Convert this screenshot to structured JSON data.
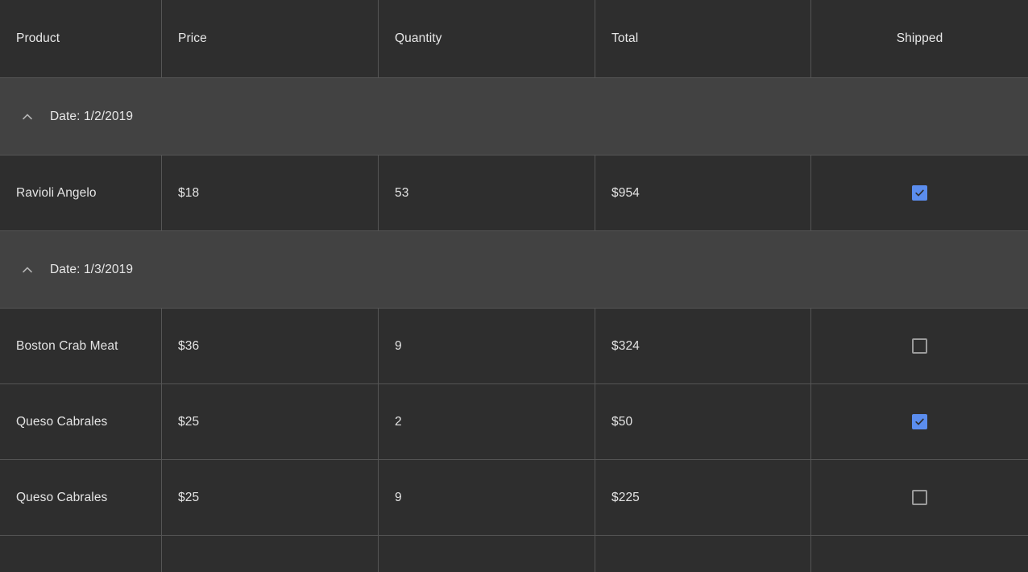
{
  "grid": {
    "columns": [
      {
        "key": "product",
        "label": "Product",
        "align": "left"
      },
      {
        "key": "price",
        "label": "Price",
        "align": "left"
      },
      {
        "key": "quantity",
        "label": "Quantity",
        "align": "left"
      },
      {
        "key": "total",
        "label": "Total",
        "align": "left"
      },
      {
        "key": "shipped",
        "label": "Shipped",
        "align": "center"
      }
    ],
    "groups": [
      {
        "label": "Date: 1/2/2019",
        "expanded": true,
        "collapse_icon": "chevron-up-icon",
        "rows": [
          {
            "product": "Ravioli Angelo",
            "price": "$18",
            "quantity": "53",
            "total": "$954",
            "shipped": true
          }
        ]
      },
      {
        "label": "Date: 1/3/2019",
        "expanded": true,
        "collapse_icon": "chevron-up-icon",
        "rows": [
          {
            "product": "Boston Crab Meat",
            "price": "$36",
            "quantity": "9",
            "total": "$324",
            "shipped": false
          },
          {
            "product": "Queso Cabrales",
            "price": "$25",
            "quantity": "2",
            "total": "$50",
            "shipped": true
          },
          {
            "product": "Queso Cabrales",
            "price": "$25",
            "quantity": "9",
            "total": "$225",
            "shipped": false
          }
        ]
      }
    ],
    "partial_row": {
      "product": "",
      "price": "",
      "quantity": "",
      "total": "",
      "shipped": null
    }
  },
  "colors": {
    "page_background": "#2e2e2e",
    "row_background": "#2e2e2e",
    "group_row_background": "#424242",
    "grid_line": "#555555",
    "text": "#e6e6e6",
    "checkbox_checked": "#5b8dee",
    "checkbox_checkmark": "#2e2e2e",
    "checkbox_unchecked_border": "#9b9b9b",
    "chevron": "#b6b6b6"
  }
}
